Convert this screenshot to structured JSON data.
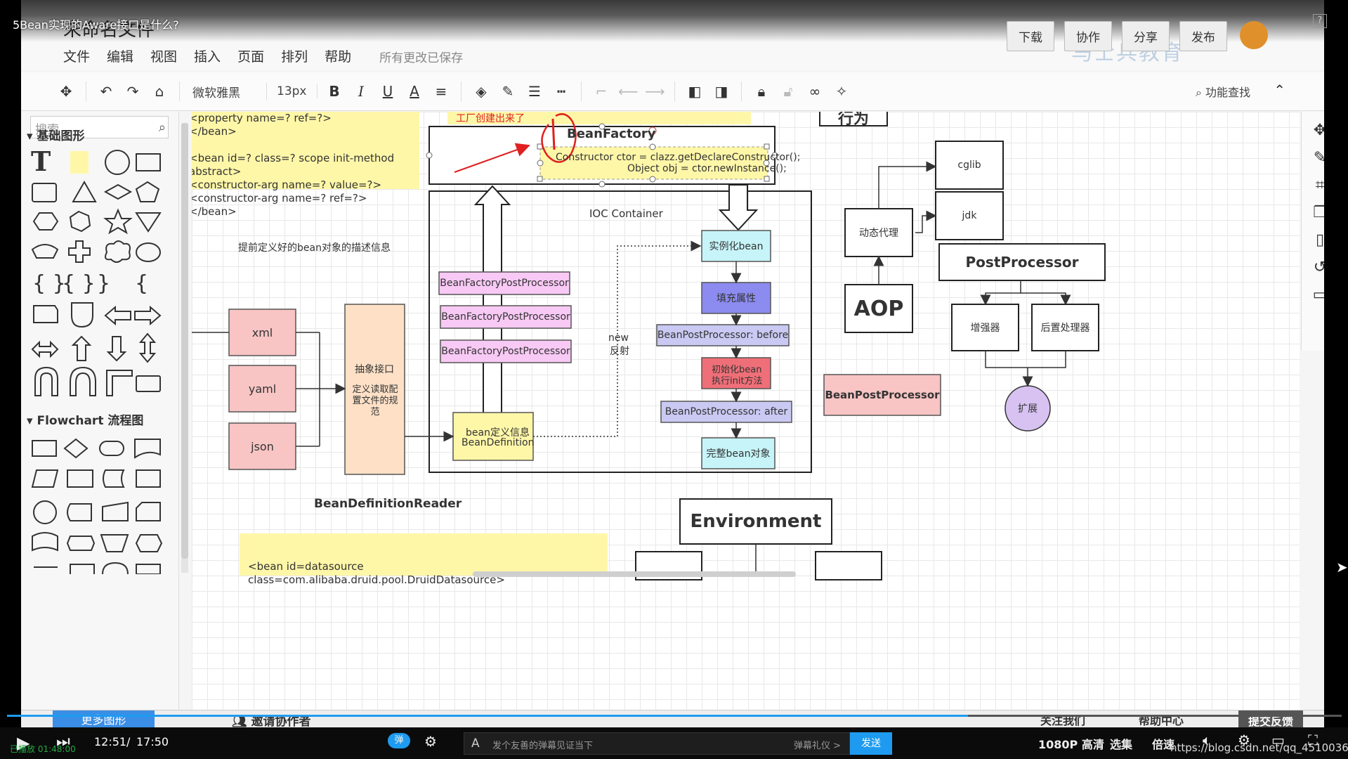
{
  "video": {
    "title": "5Bean实现的Aware接口是什么?",
    "help": "?",
    "current_time": "12:51",
    "total_time": "17:50",
    "progress_fraction": 0.72,
    "danmaku_placeholder": "发个友善的弹幕见证当下",
    "danmaku_etiquette": "弹幕礼仪 >",
    "send": "发送",
    "quality": "1080P 高清",
    "episodes": "选集",
    "speed": "倍速",
    "url_overlay": "https://blog.csdn.net/qq_45100361",
    "left_faint": "已播放 01:48:00"
  },
  "app": {
    "doc_title": "未命名文件",
    "menus": [
      "文件",
      "编辑",
      "视图",
      "插入",
      "页面",
      "排列",
      "帮助"
    ],
    "save_status": "所有更改已保存",
    "header_buttons": [
      "下载",
      "协作",
      "分享",
      "发布"
    ],
    "watermark": "马士兵教育",
    "font_name": "微软雅黑",
    "font_size": "13px",
    "find": "功能查找",
    "search_placeholder": "搜索",
    "section_basic": "基础图形",
    "section_flowchart": "Flowchart 流程图",
    "more_shapes": "更多图形",
    "invite": "邀请协作者",
    "follow_us": "关注我们",
    "help_center": "帮助中心",
    "feedback": "提交反馈"
  },
  "diagram": {
    "note_top_lines": [
      "<property name=? ref=?>",
      "</bean>",
      "",
      "<bean id=? class=? scope init-method  abstract>",
      "<constructor-arg name=? value=?>",
      "<constructor-arg  name=? ref=?>",
      "</bean>"
    ],
    "note_bottom": "<bean id=datasource class=com.alibaba.druid.pool.DruidDatasource>",
    "factory_created": "工厂创建出来了",
    "bean_factory": "BeanFactory",
    "ctor_line1": "Constructor ctor = clazz.getDeclareConstructor();",
    "ctor_line2": "Object obj = ctor.newInstance();",
    "ioc_container": "IOC  Container",
    "predefined": "提前定义好的bean对象的描述信息",
    "xml": "xml",
    "yaml": "yaml",
    "json": "json",
    "abstract_iface": "抽象接口",
    "define_read": "定义读取配置文件的规范",
    "bfpp": [
      "BeanFactoryPostProcessor",
      "BeanFactoryPostProcessor",
      "BeanFactoryPostProcessor"
    ],
    "bean_def_cn": "bean定义信息",
    "bean_def": "BeanDefinition",
    "new_reflect": [
      "new",
      "反射"
    ],
    "instantiate": "实例化bean",
    "populate": "填充属性",
    "bpp_before": "BeanPostProcessor:  before",
    "init_bean": [
      "初始化bean",
      "执行init方法"
    ],
    "bpp_after": "BeanPostProcessor:  after",
    "complete_bean": "完整bean对象",
    "reader": "BeanDefinitionReader",
    "behavior": "行为",
    "cglib": "cglib",
    "jdk": "jdk",
    "dynamic_proxy": "动态代理",
    "aop": "AOP",
    "post_processor": "PostProcessor",
    "enhancer": "增强器",
    "post_handler": "后置处理器",
    "extend": "扩展",
    "bpp": "BeanPostProcessor",
    "environment": "Environment"
  },
  "colors": {
    "note_yellow": "#fff7a8",
    "salmon": "#f8c4c4",
    "peach": "#fde0c6",
    "pink_pp": "#f8c9f5",
    "cyan": "#c6f4f8",
    "blue_fill": "#8b8bf0",
    "lavender": "#c9c9f3",
    "red_fill": "#ef6f78",
    "purple_circle": "#d7c2f2",
    "annotation_red": "#e02020",
    "accent_blue": "#1e9bf0"
  },
  "icons": {
    "toolbar": [
      "paint-format-icon",
      "undo-icon",
      "redo-icon",
      "format-brush-icon",
      "bold-icon",
      "italic-icon",
      "underline-icon",
      "font-color-icon",
      "align-icon",
      "fill-color-icon",
      "line-color-icon",
      "line-width-icon",
      "line-style-icon",
      "connector-icon",
      "arrow-start-icon",
      "arrow-end-icon",
      "to-front-icon",
      "to-back-icon",
      "lock-icon",
      "unlock-icon",
      "link-icon",
      "magic-icon"
    ],
    "right_strip": [
      "navigate-icon",
      "style-icon",
      "crop-icon",
      "pages-icon",
      "page-icon",
      "history-icon",
      "comment-icon"
    ]
  }
}
